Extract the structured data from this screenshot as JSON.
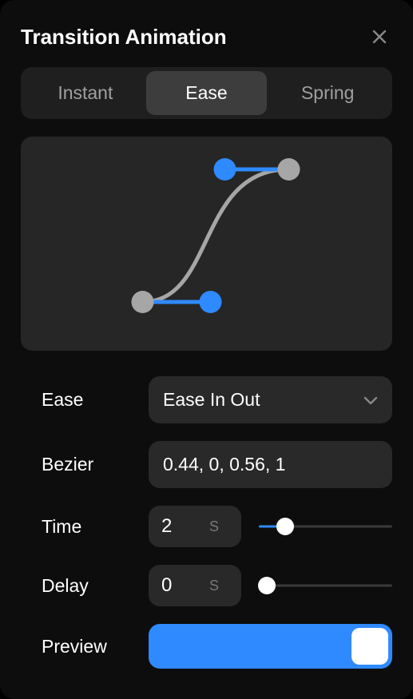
{
  "header": {
    "title": "Transition Animation"
  },
  "tabs": {
    "items": [
      {
        "label": "Instant"
      },
      {
        "label": "Ease"
      },
      {
        "label": "Spring"
      }
    ],
    "activeIndex": 1
  },
  "curve": {
    "p1x": 0.44,
    "p1y": 0,
    "p2x": 0.56,
    "p2y": 1
  },
  "fields": {
    "ease": {
      "label": "Ease",
      "value": "Ease In Out"
    },
    "bezier": {
      "label": "Bezier",
      "value": "0.44, 0, 0.56, 1"
    },
    "time": {
      "label": "Time",
      "value": "2",
      "unit": "S",
      "sliderPercent": 20
    },
    "delay": {
      "label": "Delay",
      "value": "0",
      "unit": "S",
      "sliderPercent": 0
    },
    "preview": {
      "label": "Preview",
      "on": true
    }
  },
  "colors": {
    "accent": "#2f8aff",
    "handle": "#a6a6a6"
  }
}
